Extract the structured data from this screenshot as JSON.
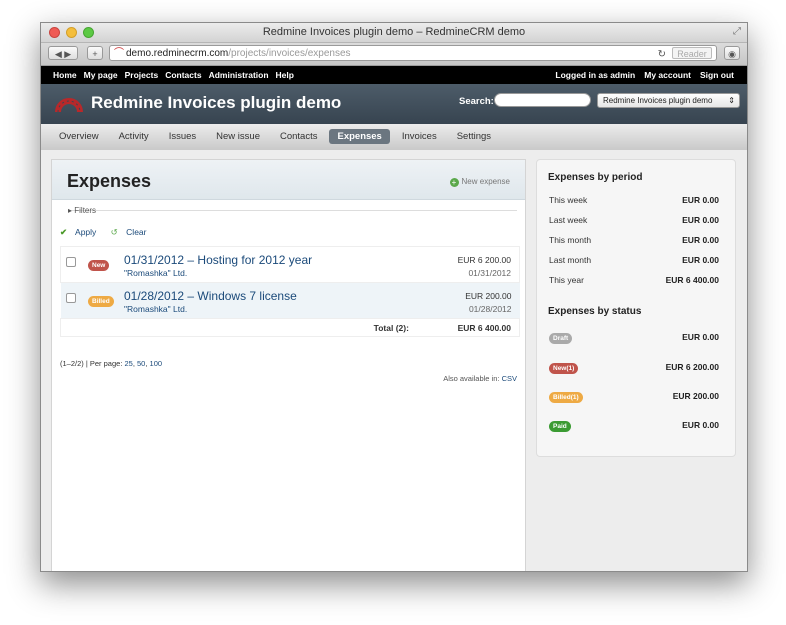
{
  "browser": {
    "window_title": "Redmine Invoices plugin demo – RedmineCRM demo",
    "url_host": "demo.redminecrm.com",
    "url_path": "/projects/invoices/expenses",
    "reader_label": "Reader"
  },
  "topmenu": {
    "left": [
      "Home",
      "My page",
      "Projects",
      "Contacts",
      "Administration",
      "Help"
    ],
    "logged_in": "Logged in as admin",
    "my_account": "My account",
    "sign_out": "Sign out"
  },
  "header": {
    "title": "Redmine Invoices plugin demo",
    "search_label": "Search:",
    "search_value": "",
    "project_selected": "Redmine Invoices plugin demo"
  },
  "mainmenu": {
    "tabs": [
      "Overview",
      "Activity",
      "Issues",
      "New issue",
      "Contacts",
      "Expenses",
      "Invoices",
      "Settings"
    ],
    "active": "Expenses"
  },
  "main": {
    "title": "Expenses",
    "new_expense": "New expense",
    "filters": "Filters",
    "apply": "Apply",
    "clear": "Clear",
    "rows": [
      {
        "status": "New",
        "title": "01/31/2012 – Hosting for 2012 year",
        "company": "\"Romashka\" Ltd.",
        "amount": "EUR 6 200.00",
        "date": "01/31/2012"
      },
      {
        "status": "Billed",
        "title": "01/28/2012 – Windows 7 license",
        "company": "\"Romashka\" Ltd.",
        "amount": "EUR 200.00",
        "date": "01/28/2012"
      }
    ],
    "total_label": "Total (2):",
    "total_value": "EUR 6 400.00",
    "pager_prefix": "(1–2/2) | Per page:",
    "pager_25": "25",
    "pager_50": "50",
    "pager_100": "100",
    "also_label": "Also available in:",
    "csv": "CSV"
  },
  "sidebar": {
    "period_title": "Expenses by period",
    "periods": [
      {
        "label": "This week",
        "value": "EUR 0.00"
      },
      {
        "label": "Last week",
        "value": "EUR 0.00"
      },
      {
        "label": "This month",
        "value": "EUR 0.00"
      },
      {
        "label": "Last month",
        "value": "EUR 0.00"
      },
      {
        "label": "This year",
        "value": "EUR 6 400.00"
      }
    ],
    "status_title": "Expenses by status",
    "statuses": [
      {
        "label": "Draft",
        "value": "EUR 0.00",
        "color": "#aaaaaa"
      },
      {
        "label": "New(1)",
        "value": "EUR 6 200.00",
        "color": "#c0544b"
      },
      {
        "label": "Billed(1)",
        "value": "EUR 200.00",
        "color": "#eeaa44"
      },
      {
        "label": "Paid",
        "value": "EUR 0.00",
        "color": "#3b9b33"
      }
    ]
  }
}
